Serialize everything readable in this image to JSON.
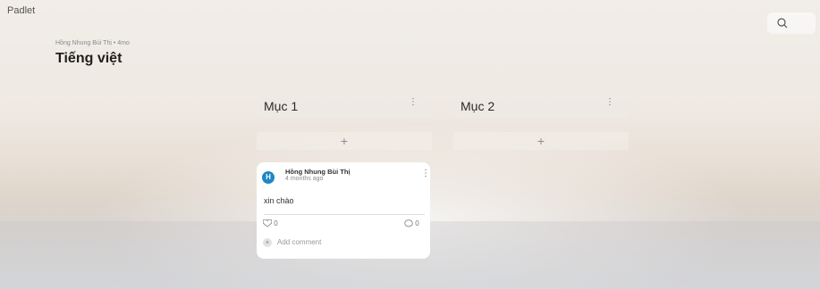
{
  "app": {
    "brand": "Padlet"
  },
  "header": {
    "meta": "Hồng Nhung Bùi Thị • 4mo",
    "title": "Tiếng việt",
    "search_icon": "search-icon"
  },
  "columns": [
    {
      "title": "Mục 1",
      "menu": "⋮",
      "add": "+"
    },
    {
      "title": "Mục 2",
      "menu": "⋮",
      "add": "+"
    }
  ],
  "post": {
    "avatar_initial": "H",
    "author": "Hồng Nhung Bùi Thị",
    "time": "4 months ago",
    "text": "xin chào",
    "menu": "⋮",
    "likes": "0",
    "comments": "0",
    "add_comment": "Add comment"
  },
  "colors": {
    "accent": "#1e88c7"
  }
}
